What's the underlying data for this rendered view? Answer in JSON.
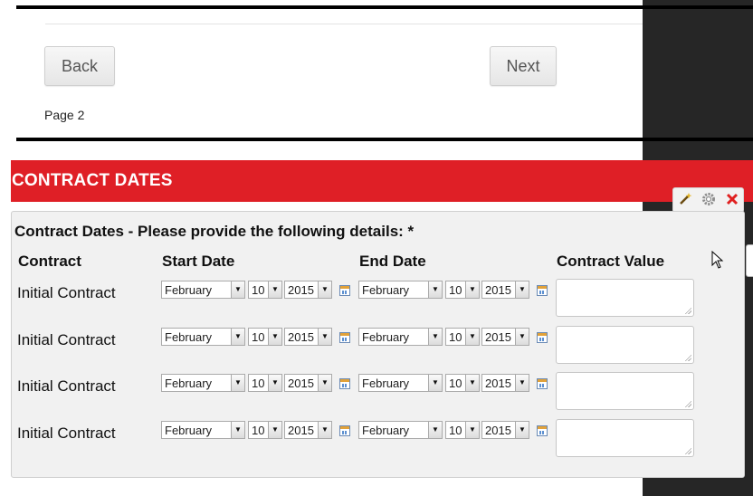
{
  "nav": {
    "back_label": "Back",
    "next_label": "Next",
    "page_label": "Page 2"
  },
  "section": {
    "title": "CONTRACT DATES"
  },
  "toolbar": {
    "icons": [
      "wand-icon",
      "gear-icon",
      "close-icon"
    ]
  },
  "form": {
    "question": "Contract Dates - Please provide the following details: *",
    "columns": [
      "Contract",
      "Start Date",
      "End Date",
      "Contract Value"
    ],
    "rows": [
      {
        "label": "Initial Contract",
        "start": {
          "month": "February",
          "day": "10",
          "year": "2015"
        },
        "end": {
          "month": "February",
          "day": "10",
          "year": "2015"
        },
        "value": ""
      },
      {
        "label": "Initial Contract",
        "start": {
          "month": "February",
          "day": "10",
          "year": "2015"
        },
        "end": {
          "month": "February",
          "day": "10",
          "year": "2015"
        },
        "value": ""
      },
      {
        "label": "Initial Contract",
        "start": {
          "month": "February",
          "day": "10",
          "year": "2015"
        },
        "end": {
          "month": "February",
          "day": "10",
          "year": "2015"
        },
        "value": ""
      },
      {
        "label": "Initial Contract",
        "start": {
          "month": "February",
          "day": "10",
          "year": "2015"
        },
        "end": {
          "month": "February",
          "day": "10",
          "year": "2015"
        },
        "value": ""
      }
    ]
  },
  "colors": {
    "accent_red": "#df1f26",
    "panel_bg": "#f1f1f1"
  }
}
